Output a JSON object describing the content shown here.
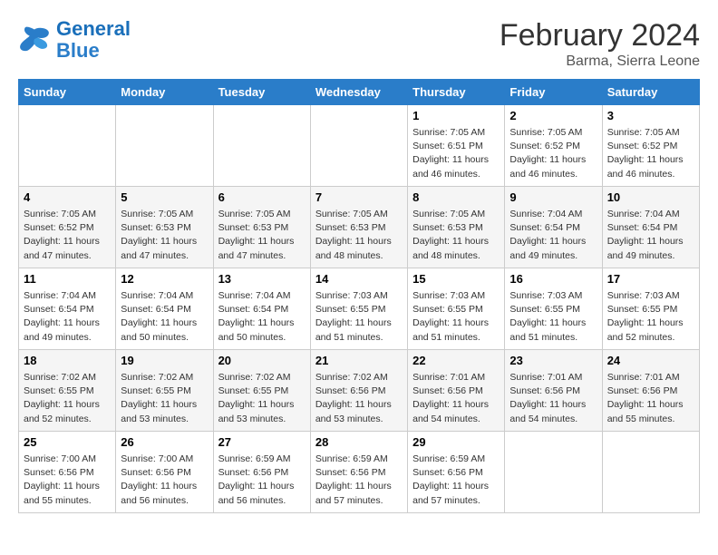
{
  "header": {
    "logo_general": "General",
    "logo_blue": "Blue",
    "month_title": "February 2024",
    "location": "Barma, Sierra Leone"
  },
  "columns": [
    "Sunday",
    "Monday",
    "Tuesday",
    "Wednesday",
    "Thursday",
    "Friday",
    "Saturday"
  ],
  "weeks": [
    [
      {
        "day": "",
        "info": ""
      },
      {
        "day": "",
        "info": ""
      },
      {
        "day": "",
        "info": ""
      },
      {
        "day": "",
        "info": ""
      },
      {
        "day": "1",
        "info": "Sunrise: 7:05 AM\nSunset: 6:51 PM\nDaylight: 11 hours\nand 46 minutes."
      },
      {
        "day": "2",
        "info": "Sunrise: 7:05 AM\nSunset: 6:52 PM\nDaylight: 11 hours\nand 46 minutes."
      },
      {
        "day": "3",
        "info": "Sunrise: 7:05 AM\nSunset: 6:52 PM\nDaylight: 11 hours\nand 46 minutes."
      }
    ],
    [
      {
        "day": "4",
        "info": "Sunrise: 7:05 AM\nSunset: 6:52 PM\nDaylight: 11 hours\nand 47 minutes."
      },
      {
        "day": "5",
        "info": "Sunrise: 7:05 AM\nSunset: 6:53 PM\nDaylight: 11 hours\nand 47 minutes."
      },
      {
        "day": "6",
        "info": "Sunrise: 7:05 AM\nSunset: 6:53 PM\nDaylight: 11 hours\nand 47 minutes."
      },
      {
        "day": "7",
        "info": "Sunrise: 7:05 AM\nSunset: 6:53 PM\nDaylight: 11 hours\nand 48 minutes."
      },
      {
        "day": "8",
        "info": "Sunrise: 7:05 AM\nSunset: 6:53 PM\nDaylight: 11 hours\nand 48 minutes."
      },
      {
        "day": "9",
        "info": "Sunrise: 7:04 AM\nSunset: 6:54 PM\nDaylight: 11 hours\nand 49 minutes."
      },
      {
        "day": "10",
        "info": "Sunrise: 7:04 AM\nSunset: 6:54 PM\nDaylight: 11 hours\nand 49 minutes."
      }
    ],
    [
      {
        "day": "11",
        "info": "Sunrise: 7:04 AM\nSunset: 6:54 PM\nDaylight: 11 hours\nand 49 minutes."
      },
      {
        "day": "12",
        "info": "Sunrise: 7:04 AM\nSunset: 6:54 PM\nDaylight: 11 hours\nand 50 minutes."
      },
      {
        "day": "13",
        "info": "Sunrise: 7:04 AM\nSunset: 6:54 PM\nDaylight: 11 hours\nand 50 minutes."
      },
      {
        "day": "14",
        "info": "Sunrise: 7:03 AM\nSunset: 6:55 PM\nDaylight: 11 hours\nand 51 minutes."
      },
      {
        "day": "15",
        "info": "Sunrise: 7:03 AM\nSunset: 6:55 PM\nDaylight: 11 hours\nand 51 minutes."
      },
      {
        "day": "16",
        "info": "Sunrise: 7:03 AM\nSunset: 6:55 PM\nDaylight: 11 hours\nand 51 minutes."
      },
      {
        "day": "17",
        "info": "Sunrise: 7:03 AM\nSunset: 6:55 PM\nDaylight: 11 hours\nand 52 minutes."
      }
    ],
    [
      {
        "day": "18",
        "info": "Sunrise: 7:02 AM\nSunset: 6:55 PM\nDaylight: 11 hours\nand 52 minutes."
      },
      {
        "day": "19",
        "info": "Sunrise: 7:02 AM\nSunset: 6:55 PM\nDaylight: 11 hours\nand 53 minutes."
      },
      {
        "day": "20",
        "info": "Sunrise: 7:02 AM\nSunset: 6:55 PM\nDaylight: 11 hours\nand 53 minutes."
      },
      {
        "day": "21",
        "info": "Sunrise: 7:02 AM\nSunset: 6:56 PM\nDaylight: 11 hours\nand 53 minutes."
      },
      {
        "day": "22",
        "info": "Sunrise: 7:01 AM\nSunset: 6:56 PM\nDaylight: 11 hours\nand 54 minutes."
      },
      {
        "day": "23",
        "info": "Sunrise: 7:01 AM\nSunset: 6:56 PM\nDaylight: 11 hours\nand 54 minutes."
      },
      {
        "day": "24",
        "info": "Sunrise: 7:01 AM\nSunset: 6:56 PM\nDaylight: 11 hours\nand 55 minutes."
      }
    ],
    [
      {
        "day": "25",
        "info": "Sunrise: 7:00 AM\nSunset: 6:56 PM\nDaylight: 11 hours\nand 55 minutes."
      },
      {
        "day": "26",
        "info": "Sunrise: 7:00 AM\nSunset: 6:56 PM\nDaylight: 11 hours\nand 56 minutes."
      },
      {
        "day": "27",
        "info": "Sunrise: 6:59 AM\nSunset: 6:56 PM\nDaylight: 11 hours\nand 56 minutes."
      },
      {
        "day": "28",
        "info": "Sunrise: 6:59 AM\nSunset: 6:56 PM\nDaylight: 11 hours\nand 57 minutes."
      },
      {
        "day": "29",
        "info": "Sunrise: 6:59 AM\nSunset: 6:56 PM\nDaylight: 11 hours\nand 57 minutes."
      },
      {
        "day": "",
        "info": ""
      },
      {
        "day": "",
        "info": ""
      }
    ]
  ]
}
